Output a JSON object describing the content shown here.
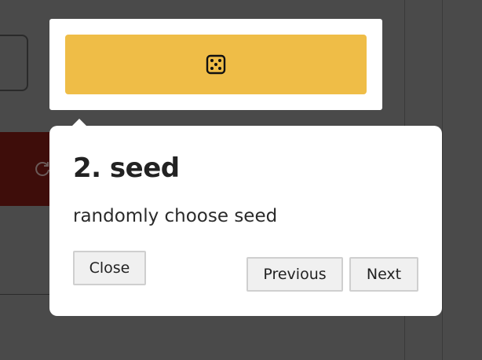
{
  "highlight": {
    "button_icon": "dice-icon",
    "button_color": "#efbd47"
  },
  "background": {
    "run_button_icon": "refresh-icon",
    "run_button_color": "#3e0d0a"
  },
  "tour": {
    "title": "2. seed",
    "description": "randomly choose seed",
    "close_label": "Close",
    "previous_label": "Previous",
    "next_label": "Next"
  }
}
